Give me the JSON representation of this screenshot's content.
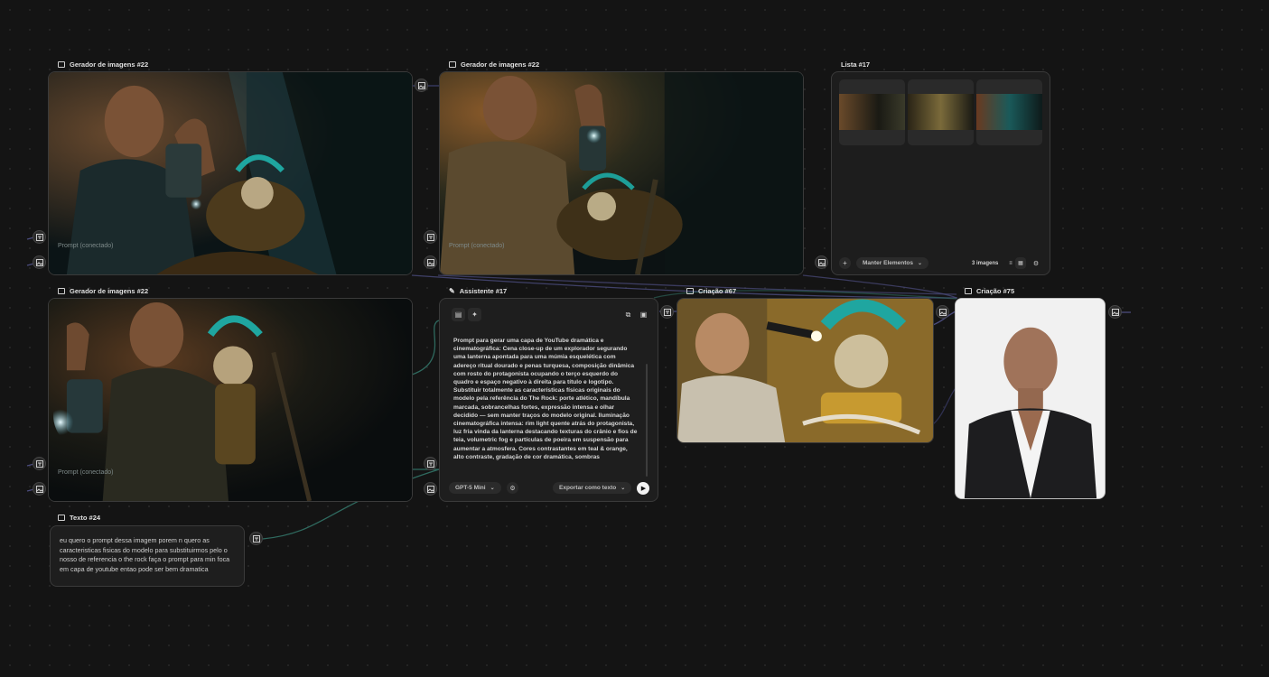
{
  "colors": {
    "canvas": "#141414",
    "node_border": "#3a3a3a",
    "teal_wire": "#2f6a5f",
    "purple_wire": "#4b4c7e"
  },
  "nodes": {
    "gen1": {
      "title": "Gerador de imagens #22",
      "prompt_label": "Prompt (conectado)",
      "icon": "image-icon"
    },
    "gen2": {
      "title": "Gerador de imagens #22",
      "prompt_label": "Prompt (conectado)",
      "icon": "image-icon"
    },
    "gen3": {
      "title": "Gerador de imagens #22",
      "prompt_label": "Prompt (conectado)",
      "icon": "image-icon"
    },
    "list": {
      "title": "Lista #17",
      "keep_label": "Manter Elementos",
      "count_label": "3 imagens",
      "icon": "image-icon"
    },
    "assistant": {
      "title": "Assistente #17",
      "icon": "pencil-icon",
      "text": "Prompt para gerar uma capa de YouTube dramática e cinematográfica: Cena close-up de um explorador segurando uma lanterna apontada para uma múmia esquelética com adereço ritual dourado e penas turquesa, composição dinâmica com rosto do protagonista ocupando o terço esquerdo do quadro e espaço negativo à direita para título e logotipo. Substituir totalmente as características físicas originais do modelo pela referência do The Rock: porte atlético, mandíbula marcada, sobrancelhas fortes, expressão intensa e olhar decidido — sem manter traços do modelo original. Iluminação cinematográfica intensa: rim light quente atrás do protagonista, luz fria vinda da lanterna destacando texturas do crânio e fios de teia, volumetric fog e partículas de poeira em suspensão para aumentar a atmosfera. Cores contrastantes em teal & orange, alto contraste, gradação de cor dramática, sombras",
      "model_label": "GPT-5 Mini",
      "export_label": "Exportar como texto"
    },
    "creation67": {
      "title": "Criação #67",
      "icon": "image-icon"
    },
    "creation75": {
      "title": "Criação #75",
      "icon": "image-icon"
    },
    "text24": {
      "title": "Texto #24",
      "icon": "text-icon",
      "text": "eu quero o prompt dessa imagem porem n quero as caracteristicas fisicas do modelo para substituirmos pelo o nosso de referencia o the rock  faça o prompt para min foca em capa de youtube entao pode ser bem dramatica"
    }
  }
}
